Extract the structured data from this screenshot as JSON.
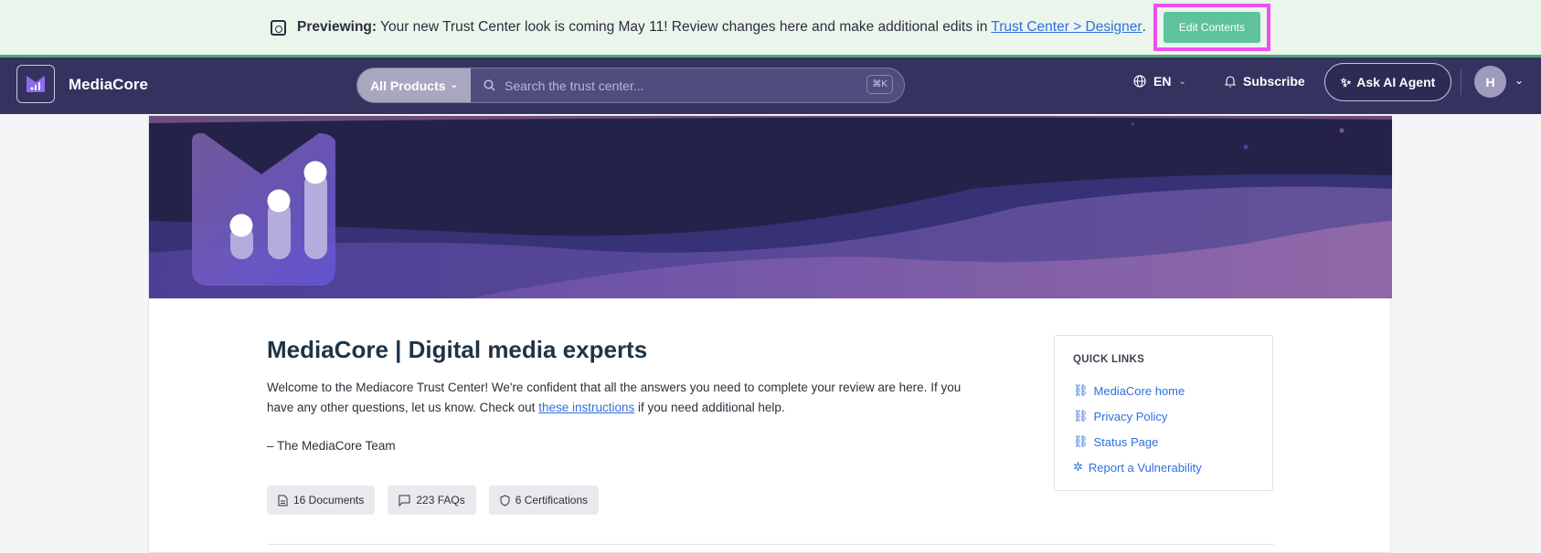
{
  "banner": {
    "icon": "preview-eye-icon",
    "label": "Previewing:",
    "message": "Your new Trust Center look is coming May 11! Review changes here and make additional edits in",
    "link": "Trust Center > Designer",
    "period": ".",
    "button": "Edit Contents"
  },
  "nav": {
    "brand": "MediaCore",
    "products": "All Products",
    "search_placeholder": "Search the trust center...",
    "shortcut": "⌘K",
    "language": "EN",
    "subscribe": "Subscribe",
    "ask_ai": "Ask AI Agent",
    "avatar": "H"
  },
  "main": {
    "title_brand": "MediaCore",
    "title_rest": " | Digital media experts",
    "para_1": "Welcome to the Mediacore Trust Center! We're confident that all the answers you need to complete your review are here. If you have any other questions, let us know. Check out ",
    "para_link": "these instructions",
    "para_2": " if you need additional help.",
    "signoff": "– The MediaCore Team",
    "chips": [
      {
        "label": "16 Documents",
        "icon": "document-icon"
      },
      {
        "label": "223 FAQs",
        "icon": "chat-icon"
      },
      {
        "label": "6 Certifications",
        "icon": "shield-icon"
      }
    ]
  },
  "quick_links": {
    "title": "QUICK LINKS",
    "items": [
      "MediaCore home",
      "Privacy Policy",
      "Status Page",
      "Report a Vulnerability"
    ]
  },
  "colors": {
    "nav": "#35325f",
    "banner": "#ebf5ec",
    "accent": "#5ec39a",
    "link": "#2f6fe0"
  }
}
